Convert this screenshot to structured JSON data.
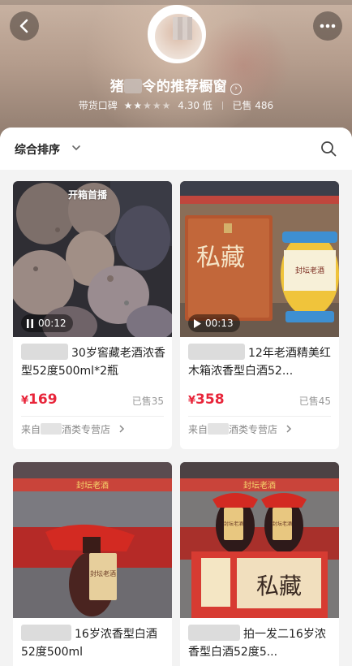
{
  "header": {
    "shop_title_pre": "猪",
    "shop_title_post": "令的推荐橱窗",
    "rating_label": "带货口碑",
    "rating_stars_on": 2,
    "rating_stars_total": 5,
    "rating_value": "4.30 低",
    "sold_label": "已售 486"
  },
  "toolbar": {
    "sort_label": "综合排序"
  },
  "products": [
    {
      "badge": "开箱首播",
      "duration": "00:12",
      "title": "30岁窖藏老酒浓香型52度500ml*2瓶",
      "currency": "¥",
      "price": "169",
      "sold": "已售35",
      "store_pre": "来自",
      "store_post": "酒类专营店"
    },
    {
      "duration": "00:13",
      "title": "12年老酒精美红木箱浓香型白酒52...",
      "currency": "¥",
      "price": "358",
      "sold": "已售45",
      "store_pre": "来自",
      "store_post": "酒类专营店",
      "box_brand": "私藏",
      "jar_label": "封坛老酒"
    },
    {
      "title": "16岁浓香型白酒52度500ml",
      "banner": "封坛老酒",
      "bottle_label": "封坛老酒"
    },
    {
      "title": "拍一发二16岁浓香型白酒52度5...",
      "banner": "封坛老酒",
      "box_brand": "私藏",
      "bottle_label": "封坛老酒"
    }
  ],
  "colors": {
    "price_red": "#e8253a",
    "header_brown": "#b49c8c"
  }
}
